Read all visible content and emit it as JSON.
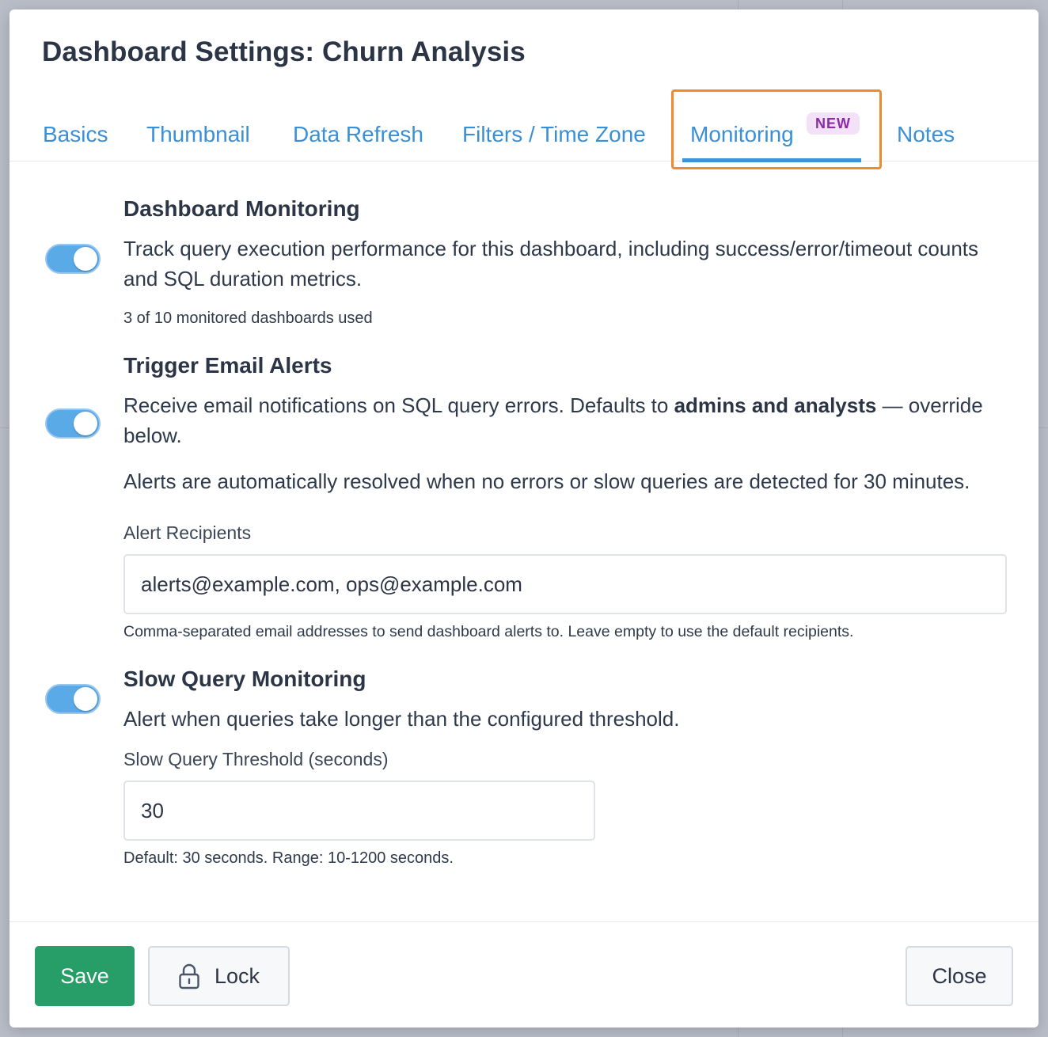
{
  "modal": {
    "title": "Dashboard Settings: Churn Analysis"
  },
  "tabs": [
    {
      "label": "Basics",
      "active": false
    },
    {
      "label": "Thumbnail",
      "active": false
    },
    {
      "label": "Data Refresh",
      "active": false
    },
    {
      "label": "Filters / Time Zone",
      "active": false
    },
    {
      "label": "Monitoring",
      "active": true,
      "badge": "NEW"
    },
    {
      "label": "Notes",
      "active": false
    }
  ],
  "monitoring": {
    "title": "Dashboard Monitoring",
    "enabled": true,
    "description": "Track query execution performance for this dashboard, including success/error/timeout counts and SQL duration metrics.",
    "usage": "3 of 10 monitored dashboards used"
  },
  "email_alerts": {
    "title": "Trigger Email Alerts",
    "enabled": true,
    "description_prefix": "Receive email notifications on SQL query errors. Defaults to ",
    "description_bold": "admins and analysts",
    "description_suffix": " — override below.",
    "resolve_note": "Alerts are automatically resolved when no errors or slow queries are detected for 30 minutes.",
    "recipients_label": "Alert Recipients",
    "recipients_value": "alerts@example.com, ops@example.com",
    "recipients_help": "Comma-separated email addresses to send dashboard alerts to. Leave empty to use the default recipients."
  },
  "slow_query": {
    "title": "Slow Query Monitoring",
    "enabled": true,
    "description": "Alert when queries take longer than the configured threshold.",
    "threshold_label": "Slow Query Threshold (seconds)",
    "threshold_value": "30",
    "threshold_help": "Default: 30 seconds. Range: 10-1200 seconds."
  },
  "footer": {
    "save_label": "Save",
    "lock_label": "Lock",
    "close_label": "Close"
  },
  "colors": {
    "accent": "#3a94dc",
    "primary_button": "#279d68",
    "highlight_outline": "#f08a2a",
    "badge_text": "#8a2ba8",
    "badge_bg": "#f2e1f7"
  }
}
